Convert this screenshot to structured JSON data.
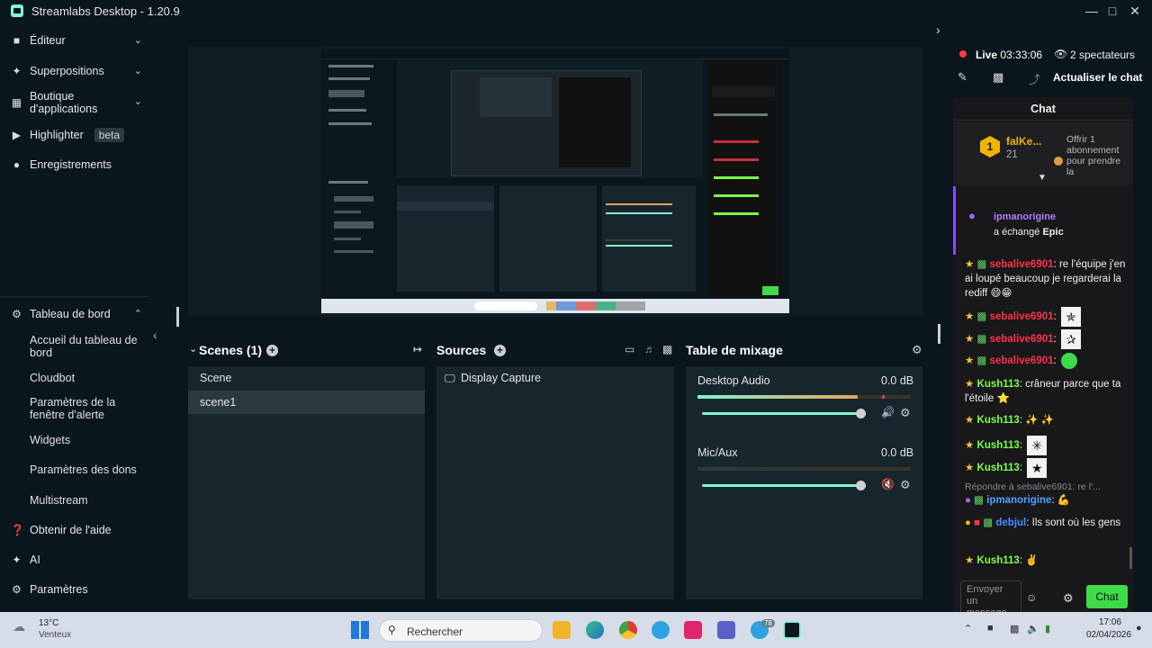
{
  "window": {
    "title": "Streamlabs Desktop - 1.20.9"
  },
  "sidebar": {
    "items": [
      {
        "label": "Éditeur"
      },
      {
        "label": "Superpositions"
      },
      {
        "label": "Boutique d'applications"
      },
      {
        "label": "Highlighter",
        "badge": "beta"
      },
      {
        "label": "Enregistrements"
      },
      {
        "label": "Tableau de bord"
      },
      {
        "label": "Obtenir de l'aide"
      },
      {
        "label": "AI"
      },
      {
        "label": "Paramètres"
      }
    ],
    "dashboard_sub": [
      {
        "label": "Accueil du tableau de bord"
      },
      {
        "label": "Cloudbot"
      },
      {
        "label": "Paramètres de la fenêtre d'alerte"
      },
      {
        "label": "Widgets"
      },
      {
        "label": "Paramètres des dons"
      },
      {
        "label": "Multistream"
      }
    ]
  },
  "scenes": {
    "title": "Scenes (1)",
    "header": "Scene",
    "items": [
      "scene1"
    ]
  },
  "sources": {
    "title": "Sources",
    "items": [
      "Display Capture"
    ]
  },
  "mixer": {
    "title": "Table de mixage",
    "channels": [
      {
        "name": "Desktop Audio",
        "db": "0.0 dB",
        "level": 0.75
      },
      {
        "name": "Mic/Aux",
        "db": "0.0 dB",
        "level": 0.0
      }
    ]
  },
  "live": {
    "status": "Live",
    "time": "03:33:06",
    "viewers": "2 spectateurs",
    "refresh": "Actualiser le chat"
  },
  "chat": {
    "title": "Chat",
    "top_user": {
      "name": "falKe...",
      "count": "21"
    },
    "gift_text": "Offrir 1 abonnement pour prendre la",
    "redeem": {
      "user": "ipmanorigine",
      "action": "a échangé",
      "reward": "Epic"
    },
    "messages": [
      {
        "user": "sebalive6901",
        "text": "re l'équipe j'en ai loupé beaucoup je regarderai la rediff 😄😁",
        "color": "#ff3347"
      },
      {
        "user": "sebalive6901",
        "text": "",
        "color": "#ff3347"
      },
      {
        "user": "sebalive6901",
        "text": "",
        "color": "#ff3347"
      },
      {
        "user": "sebalive6901",
        "text": "",
        "color": "#ff3347"
      },
      {
        "user": "Kush113",
        "text": "crâneur parce que ta l'étoile ⭐",
        "color": "#7cff4a"
      },
      {
        "user": "Kush113",
        "text": "",
        "color": "#7cff4a"
      },
      {
        "user": "Kush113",
        "text": "",
        "color": "#7cff4a"
      },
      {
        "user": "Kush113",
        "text": "",
        "color": "#7cff4a"
      },
      {
        "user": "ipmanorigine",
        "text": "💪",
        "color": "#4ea3ff"
      },
      {
        "user": "debjul",
        "text": "Ils sont où les gens",
        "color": "#4a8cff"
      },
      {
        "user": "Kush113",
        "text": "✌️",
        "color": "#7cff4a"
      }
    ],
    "reply_ref": "Répondre à sebalive6901: re l'...",
    "input_placeholder": "Envoyer un message",
    "send_label": "Chat"
  },
  "taskbar": {
    "weather_temp": "13°C",
    "weather_desc": "Venteux",
    "search": "Rechercher",
    "time": "17:06",
    "date": "02/04/2026",
    "badge": "78"
  }
}
